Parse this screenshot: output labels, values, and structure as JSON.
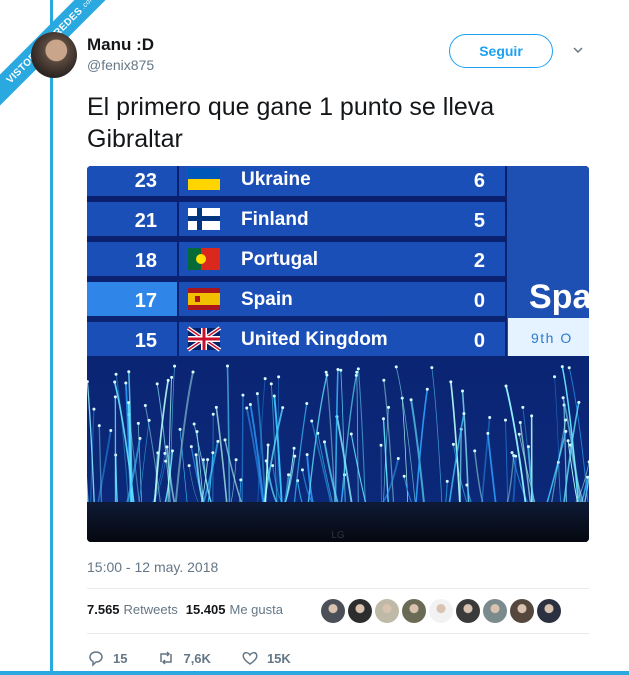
{
  "watermark": {
    "main": "VISTOENLASREDES",
    ".com": ".com"
  },
  "user": {
    "name": "Manu :D",
    "handle": "@fenix875"
  },
  "follow_label": "Seguir",
  "tweet_text": "El primero que gane 1 punto se lleva Gibraltar",
  "scoreboard": {
    "rows": [
      {
        "rank": "23",
        "country": "Ukraine",
        "points": "6"
      },
      {
        "rank": "21",
        "country": "Finland",
        "points": "5"
      },
      {
        "rank": "18",
        "country": "Portugal",
        "points": "2"
      },
      {
        "rank": "17",
        "country": "Spain",
        "points": "0"
      },
      {
        "rank": "15",
        "country": "United Kingdom",
        "points": "0"
      }
    ],
    "side_big": "Spa",
    "side_small": "9th O",
    "floor_text": "LG"
  },
  "timestamp": "15:00 - 12 may. 2018",
  "stats": {
    "retweets_count": "7.565",
    "retweets_label": "Retweets",
    "likes_count": "15.405",
    "likes_label": "Me gusta"
  },
  "actions": {
    "replies": "15",
    "retweets": "7,6K",
    "likes": "15K"
  },
  "colors": {
    "accent": "#1da1f2",
    "frame": "#2aa8e0",
    "board_bg": "#1b4fb8",
    "board_hl": "#2f86e8"
  }
}
